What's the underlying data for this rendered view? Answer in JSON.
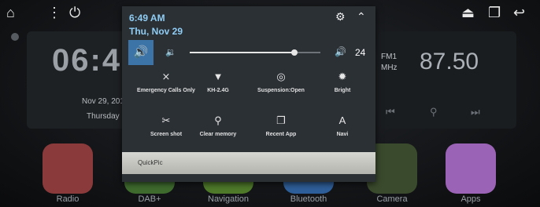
{
  "statusbar": {
    "home_icon": "home-icon",
    "menu_icon": "more-vert-icon",
    "power_icon": "power-icon",
    "eject_icon": "eject-icon",
    "recents_icon": "recents-icon",
    "back_icon": "back-icon"
  },
  "clock_widget": {
    "time": "06:4",
    "date": "Nov 29, 201",
    "day": "Thursday"
  },
  "radio_widget": {
    "band": "FM1",
    "unit": "MHz",
    "frequency": "87.50"
  },
  "apps": [
    {
      "label": "Radio",
      "color": "#8a3a3a"
    },
    {
      "label": "DAB+",
      "color": "#3f6b2e"
    },
    {
      "label": "Navigation",
      "color": "#4f7a2a"
    },
    {
      "label": "Bluetooth",
      "color": "#2f5f9a"
    },
    {
      "label": "Camera",
      "color": "#3a4a2c"
    },
    {
      "label": "Apps",
      "color": "#9b63b5"
    }
  ],
  "quick_panel": {
    "time": "6:49 AM",
    "date": "Thu, Nov 29",
    "volume": {
      "value": 24,
      "fraction": 0.8
    },
    "accent": "#3c74a8",
    "toggles": [
      {
        "label": "Emergency Calls Only",
        "icon": "no-signal-icon",
        "glyph": "⨯"
      },
      {
        "label": "KH-2.4G",
        "icon": "wifi-icon",
        "glyph": "▼"
      },
      {
        "label": "Suspension:Open",
        "icon": "suspension-icon",
        "glyph": "◎"
      },
      {
        "label": "Bright",
        "icon": "brightness-icon",
        "glyph": "✹"
      },
      {
        "label": "Screen shot",
        "icon": "scissors-icon",
        "glyph": "✂"
      },
      {
        "label": "Clear memory",
        "icon": "broom-icon",
        "glyph": "⚲"
      },
      {
        "label": "Recent App",
        "icon": "recent-apps-icon",
        "glyph": "❐"
      },
      {
        "label": "Navi",
        "icon": "navi-icon",
        "glyph": "A"
      }
    ],
    "notification": "QuickPic"
  }
}
